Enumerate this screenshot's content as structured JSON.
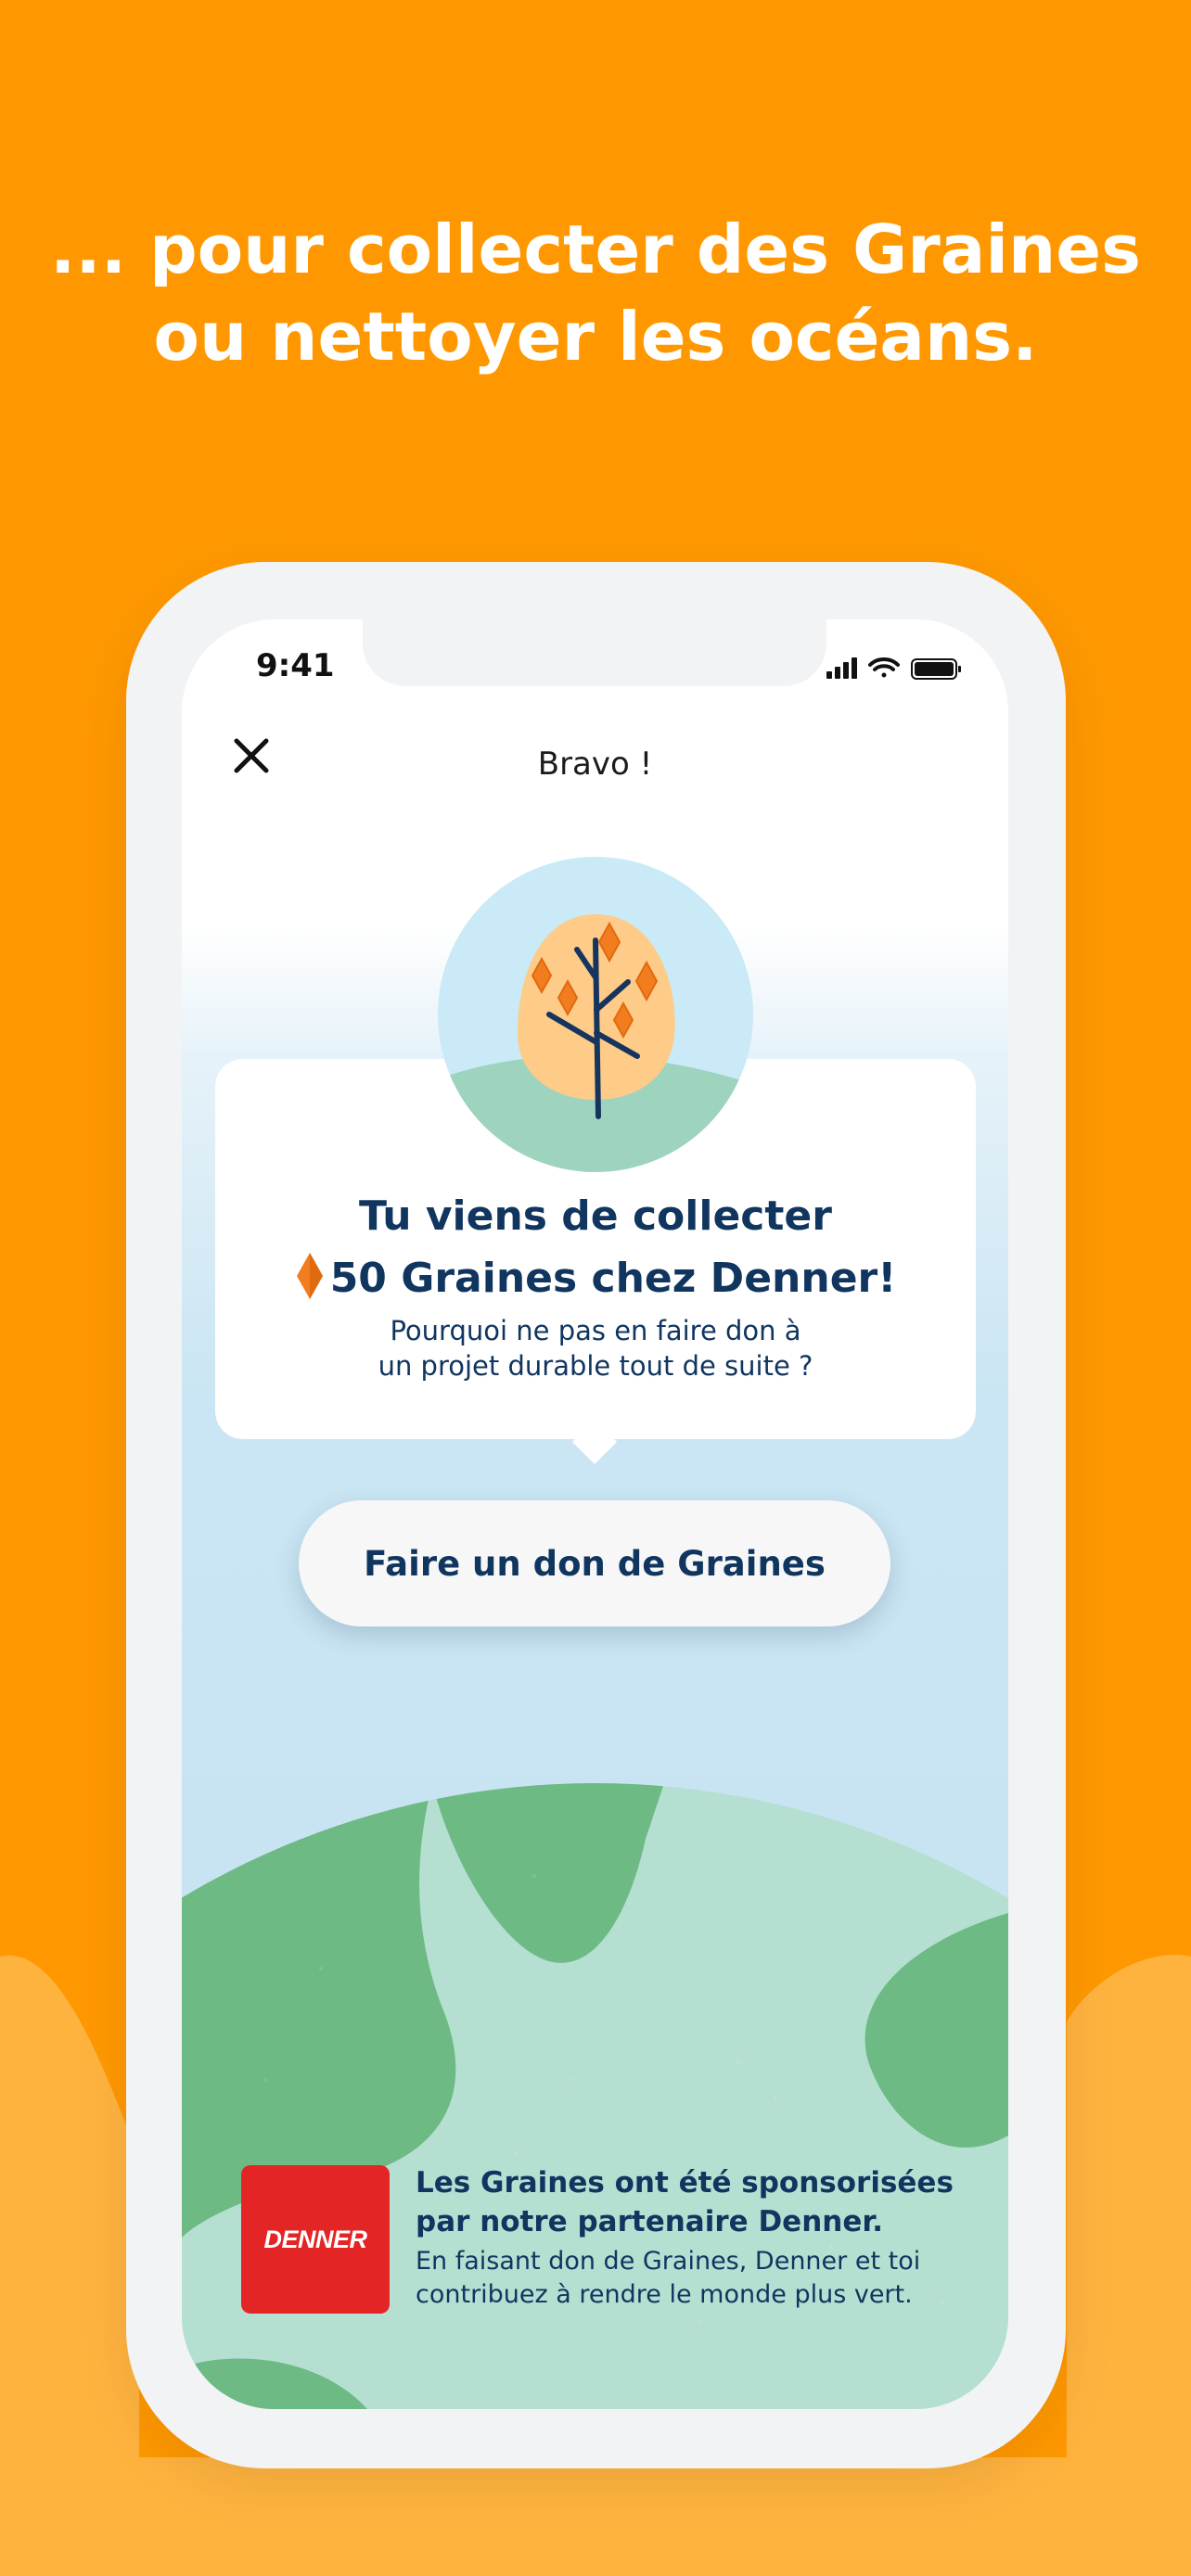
{
  "marketing": {
    "headline_line1": "... pour collecter des Graines",
    "headline_line2": "ou nettoyer les océans."
  },
  "status_bar": {
    "time": "9:41",
    "icons": [
      "signal-icon",
      "wifi-icon",
      "battery-icon"
    ]
  },
  "nav": {
    "title": "Bravo !",
    "close_icon": "close-icon"
  },
  "reward_card": {
    "title_line1": "Tu viens de collecter",
    "title_line2": "50 Graines chez Denner!",
    "seed_icon": "seed-icon",
    "subtitle_line1": "Pourquoi ne pas en faire don à",
    "subtitle_line2": "un projet durable tout de suite ?",
    "illustration": "tree-illustration"
  },
  "donate_button": {
    "label": "Faire un don de Graines"
  },
  "sponsor": {
    "logo_text": "DENNER",
    "title_line1": "Les Graines ont été sponsorisées",
    "title_line2": "par notre partenaire Denner.",
    "body_line1": "En faisant don de Graines, Denner et toi",
    "body_line2": "contribuez à rendre le monde plus vert."
  },
  "colors": {
    "background_orange": "#FF9800",
    "wave_orange": "#FFB33F",
    "text_navy": "#10355F",
    "globe_land": "#6DBA84",
    "globe_water": "#B4DFD1",
    "denner_red": "#E32526"
  }
}
